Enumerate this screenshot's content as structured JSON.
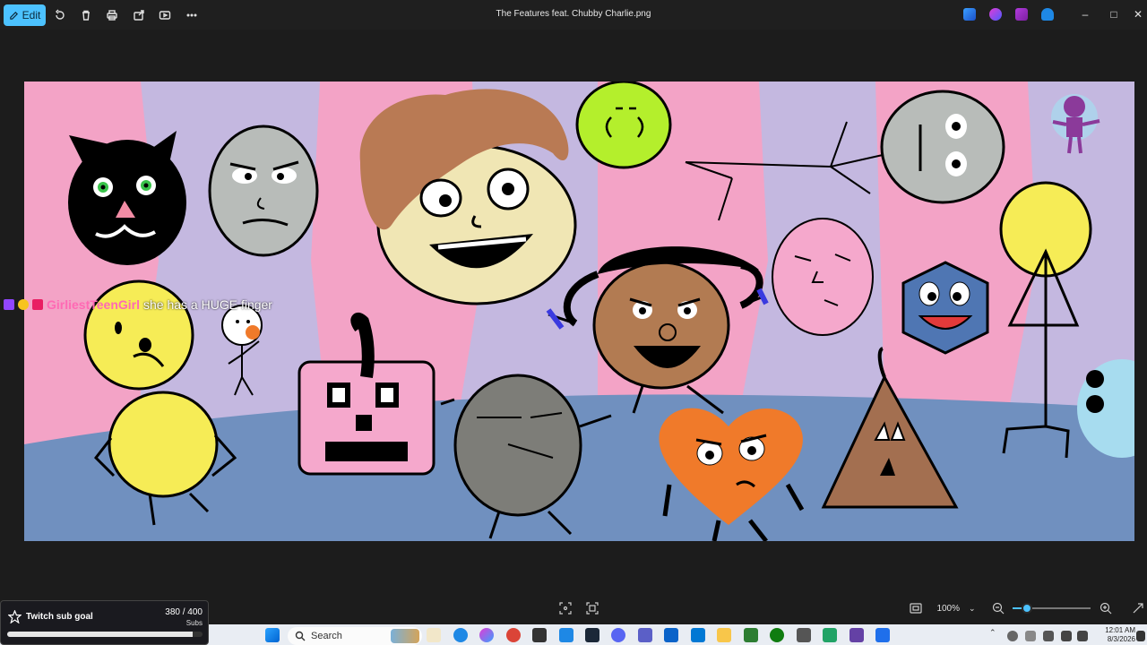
{
  "toolbar": {
    "edit_label": "Edit",
    "icons": [
      "rotate-icon",
      "delete-icon",
      "print-icon",
      "share-icon",
      "slideshow-icon",
      "more-icon"
    ]
  },
  "window": {
    "title": "The Features feat. Chubby Charlie.png"
  },
  "chat_overlay": {
    "username": "GirliestTeenGirl",
    "message": "she has a HUGE finger",
    "username_color": "#ff69b4"
  },
  "bottom_bar": {
    "zoom_value": "100%",
    "zoom_fraction": 0.18
  },
  "sub_goal": {
    "title": "Twitch sub goal",
    "count": "380 / 400",
    "unit": "Subs",
    "progress": 0.95
  },
  "taskbar": {
    "search_placeholder": "Search",
    "time": "12:01 AM",
    "date": "8/3/2026"
  },
  "colors": {
    "accent": "#4cc2ff",
    "titlebar_bg": "#1f1f1f",
    "taskbar_bg": "#e9edf3"
  }
}
